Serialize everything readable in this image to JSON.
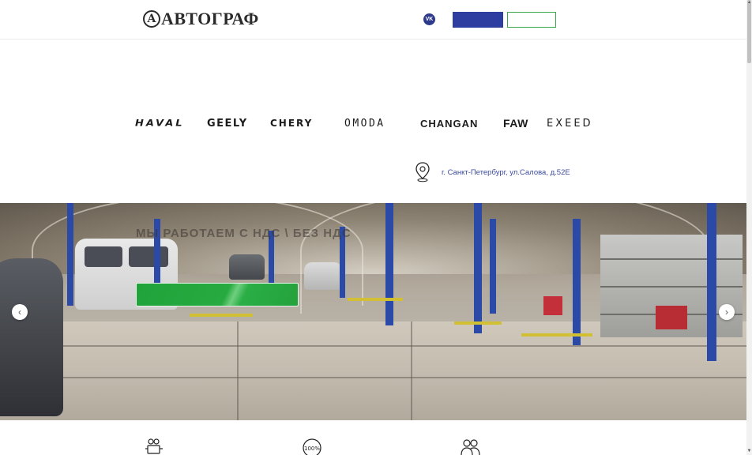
{
  "header": {
    "logo_mark": "А",
    "logo_text": "АВТОГРАФ",
    "vk_label": "VK"
  },
  "brands": [
    "HAVAL",
    "GEELY",
    "CHERY",
    "OMODA",
    "CHANGAN",
    "FAW",
    "EXEED"
  ],
  "address": "г. Санкт-Петербург, ул.Салова, д.52Е",
  "hero": {
    "title": "МЫ РАБОТАЕМ С НДС \\ БЕЗ НДС",
    "prev_icon": "chevron-left-icon",
    "next_icon": "chevron-right-icon",
    "prev_glyph": "‹",
    "next_glyph": "›"
  },
  "features": [
    {
      "icon": "engine-icon"
    },
    {
      "icon": "percent-100-icon",
      "label": "100%"
    },
    {
      "icon": "people-icon"
    }
  ],
  "colors": {
    "brand_blue": "#2d3ea0",
    "accent_green": "#27ab41",
    "address_text": "#3b4a9c"
  }
}
